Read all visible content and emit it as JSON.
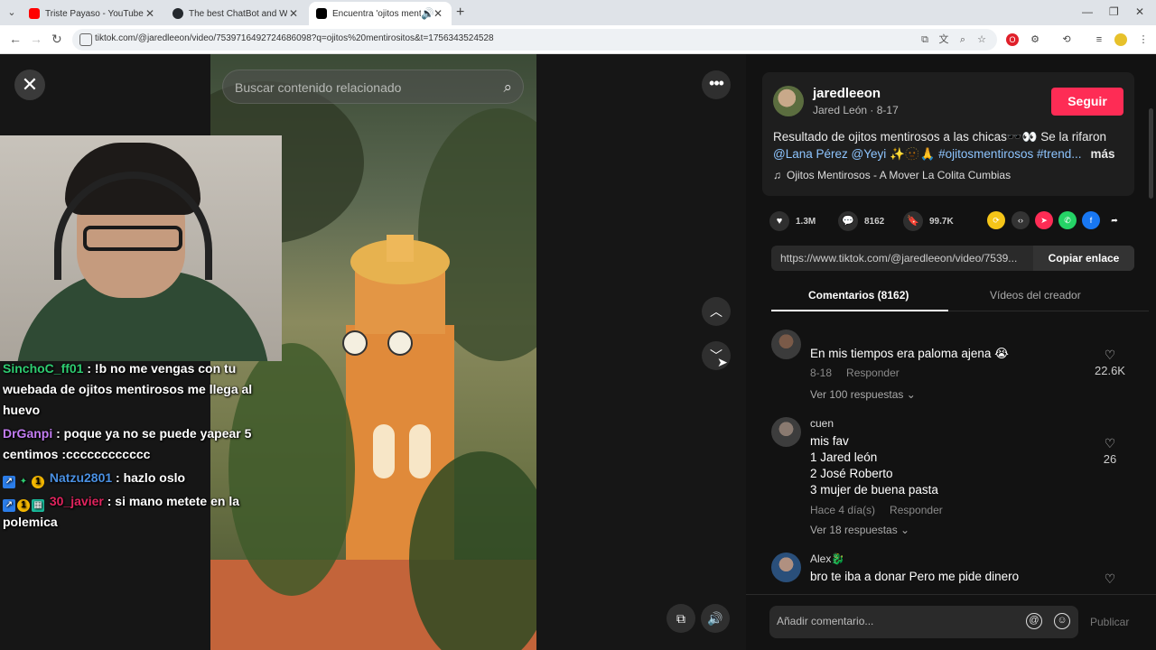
{
  "browser": {
    "tabs": [
      {
        "title": "Triste Payaso - YouTube",
        "fav_color": "#ff0000"
      },
      {
        "title": "The best ChatBot and Widgets",
        "fav_color": "#24292e"
      },
      {
        "title": "Encuentra 'ojitos mentirosi",
        "fav_color": "#000000"
      }
    ],
    "url": "tiktok.com/@jaredleeon/video/7539716492724686098?q=ojitos%20mentirositos&t=1756343524528"
  },
  "video": {
    "search_placeholder": "Buscar contenido relacionado"
  },
  "chat": [
    {
      "user": "SinchoC_ff01",
      "text": " : !b no me vengas con tu wuebada de ojitos mentirosos me llega al huevo"
    },
    {
      "user": "DrGanpi",
      "text": " : poque ya no se puede yapear 5 centimos :cccccccccccc"
    },
    {
      "user": "Natzu2801",
      "text": " : hazlo oslo"
    },
    {
      "user": "30_javier",
      "text": " : si mano metete en la polemica"
    }
  ],
  "panel": {
    "username": "jaredleeon",
    "display_name": "Jared León",
    "date": "8-17",
    "follow_label": "Seguir",
    "caption": "Resultado de ojitos mentirosos a las chicas🕶️👀 Se la rifaron",
    "caption_tags": "@Lana Pérez @Yeyi ✨🫥🙏 #ojitosmentirosos #trend...",
    "more_label": "más",
    "music": "Ojitos Mentirosos - A Mover La Colita Cumbias",
    "likes": "1.3M",
    "comments_count": "8162",
    "saves": "99.7K",
    "link_url": "https://www.tiktok.com/@jaredleeon/video/7539...",
    "copy_label": "Copiar enlace",
    "tab_comments": "Comentarios (8162)",
    "tab_creator": "Vídeos del creador",
    "comments": [
      {
        "user": "",
        "text": "En mis tiempos era paloma ajena 😭",
        "date": "8-18",
        "reply": "Responder",
        "replies": "Ver 100 respuestas ⌄",
        "likes": "22.6K"
      },
      {
        "user": "cuen",
        "text_lines": [
          "mis fav",
          "1 Jared león",
          "2 José Roberto",
          "3 mujer de buena pasta"
        ],
        "date": "Hace 4 día(s)",
        "reply": "Responder",
        "replies": "Ver 18 respuestas ⌄",
        "likes": "26"
      },
      {
        "user": "Alex🐉",
        "text": "bro te iba a donar Pero me pide dinero",
        "likes": ""
      }
    ],
    "add_comment_placeholder": "Añadir comentario...",
    "publish_label": "Publicar"
  },
  "colors": {
    "follow": "#fe2c55",
    "tag": "#8ec5ff"
  }
}
